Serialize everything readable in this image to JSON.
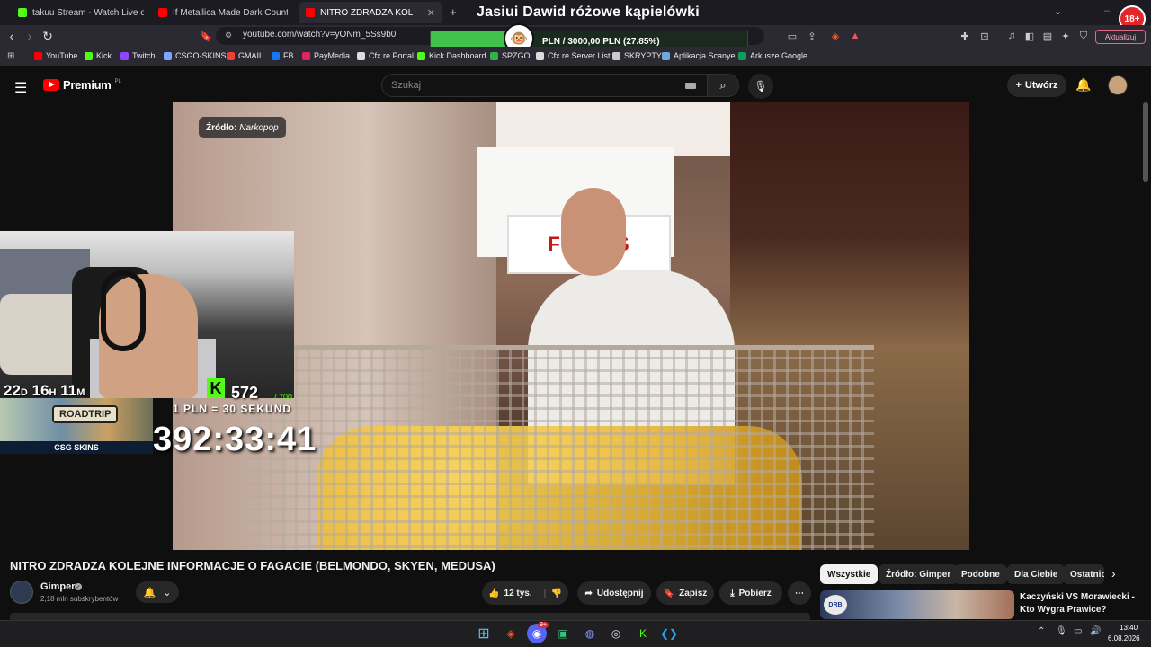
{
  "browser": {
    "tabs": [
      {
        "title": "takuu Stream - Watch Live on Ki",
        "color": "#53fc18"
      },
      {
        "title": "If Metallica Made Dark Country (Seri",
        "color": "#ff0000"
      },
      {
        "title": "NITRO ZDRADZA KOLEJNE INFO",
        "color": "#ff0000",
        "active": true
      }
    ],
    "new_tab": "+",
    "url": "youtube.com/watch?v=yONm_5Ss9b0",
    "update_label": "Aktualizuj",
    "bookmarks": [
      {
        "label": "YouTube",
        "color": "#ff0000"
      },
      {
        "label": "Kick",
        "color": "#53fc18"
      },
      {
        "label": "Twitch",
        "color": "#9146ff"
      },
      {
        "label": "CSGO-SKINS",
        "color": "#7aa6ff"
      },
      {
        "label": "GMAIL",
        "color": "#ea4335"
      },
      {
        "label": "FB",
        "color": "#1877f2"
      },
      {
        "label": "PayMedia",
        "color": "#e0245e"
      },
      {
        "label": "Cfx.re Portal",
        "color": "#dddddd"
      },
      {
        "label": "Kick Dashboard",
        "color": "#53fc18"
      },
      {
        "label": "SPZGO",
        "color": "#2db34a"
      },
      {
        "label": "Cfx.re Server List",
        "color": "#dddddd"
      },
      {
        "label": "SKRYPTY",
        "color": "#cccccc"
      },
      {
        "label": "Aplikacja Scanye",
        "color": "#6fa8dc"
      },
      {
        "label": "Arkusze Google",
        "color": "#0f9d58"
      }
    ]
  },
  "stream_overlay": {
    "title": "Jasiui Dawid różowe kąpielówki",
    "donation_text": "PLN / 3000,00 PLN  (27.85%)",
    "donation_progress": 0.2785,
    "badge": "18+",
    "timer_small": {
      "days": "22",
      "d": "D",
      "hours": "16",
      "h": "H",
      "minutes": "11",
      "m": "M"
    },
    "viewers": "572",
    "viewers_goal": "/ 700",
    "kick_letter": "K",
    "rate": "1 PLN = 30 SEKUND",
    "big_timer": "392:33:41",
    "ad_roadtrip": "ROADTRIP",
    "ad_brand": "CSG SKINS"
  },
  "youtube": {
    "logo_text": "Premium",
    "region": "PL",
    "search_placeholder": "Szukaj",
    "create_label": "Utwórz",
    "video": {
      "source_label": "Źródło:",
      "source_name": "Narkopop",
      "sign_text": "FISH TS"
    },
    "title": "NITRO ZDRADZA KOLEJNE INFORMACJE O FAGACIE (BELMONDO, SKYEN, MEDUSA)",
    "channel": {
      "name": "Gimper",
      "subs": "2,18 mln subskrybentów"
    },
    "actions": {
      "likes": "12 tys.",
      "share": "Udostępnij",
      "save": "Zapisz",
      "download": "Pobierz",
      "more": "⋯"
    },
    "chips": [
      "Wszystkie",
      "Źródło: Gimper",
      "Podobne",
      "Dla Ciebie",
      "Ostatnio"
    ],
    "recommendation": {
      "title": "Kaczyński VS Morawiecki - Kto Wygra Prawice?",
      "logo": "DRB"
    }
  },
  "taskbar": {
    "time": "13:40",
    "date": "6.08.2026",
    "discord_badge": "9+"
  }
}
